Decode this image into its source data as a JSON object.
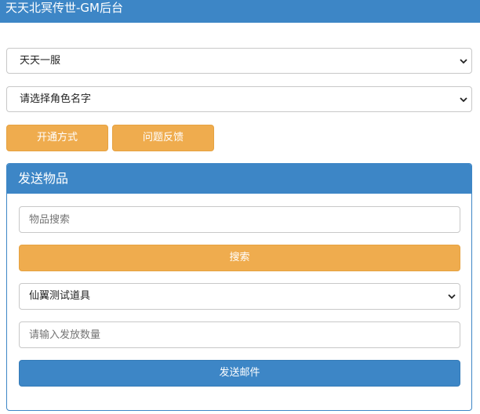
{
  "header": {
    "title": "天天北冥传世-GM后台"
  },
  "server_select": {
    "selected": "天天一服"
  },
  "role_select": {
    "selected": "请选择角色名字"
  },
  "actions": {
    "open_method_label": "开通方式",
    "feedback_label": "问题反馈"
  },
  "send_panel": {
    "title": "发送物品",
    "item_search": {
      "placeholder": "物品搜索",
      "value": ""
    },
    "search_button_label": "搜索",
    "item_select": {
      "selected": "仙翼测试道具"
    },
    "quantity": {
      "placeholder": "请输入发放数量",
      "value": ""
    },
    "send_button_label": "发送邮件"
  },
  "colors": {
    "primary": "#3d86c6",
    "warning": "#efac4e"
  }
}
